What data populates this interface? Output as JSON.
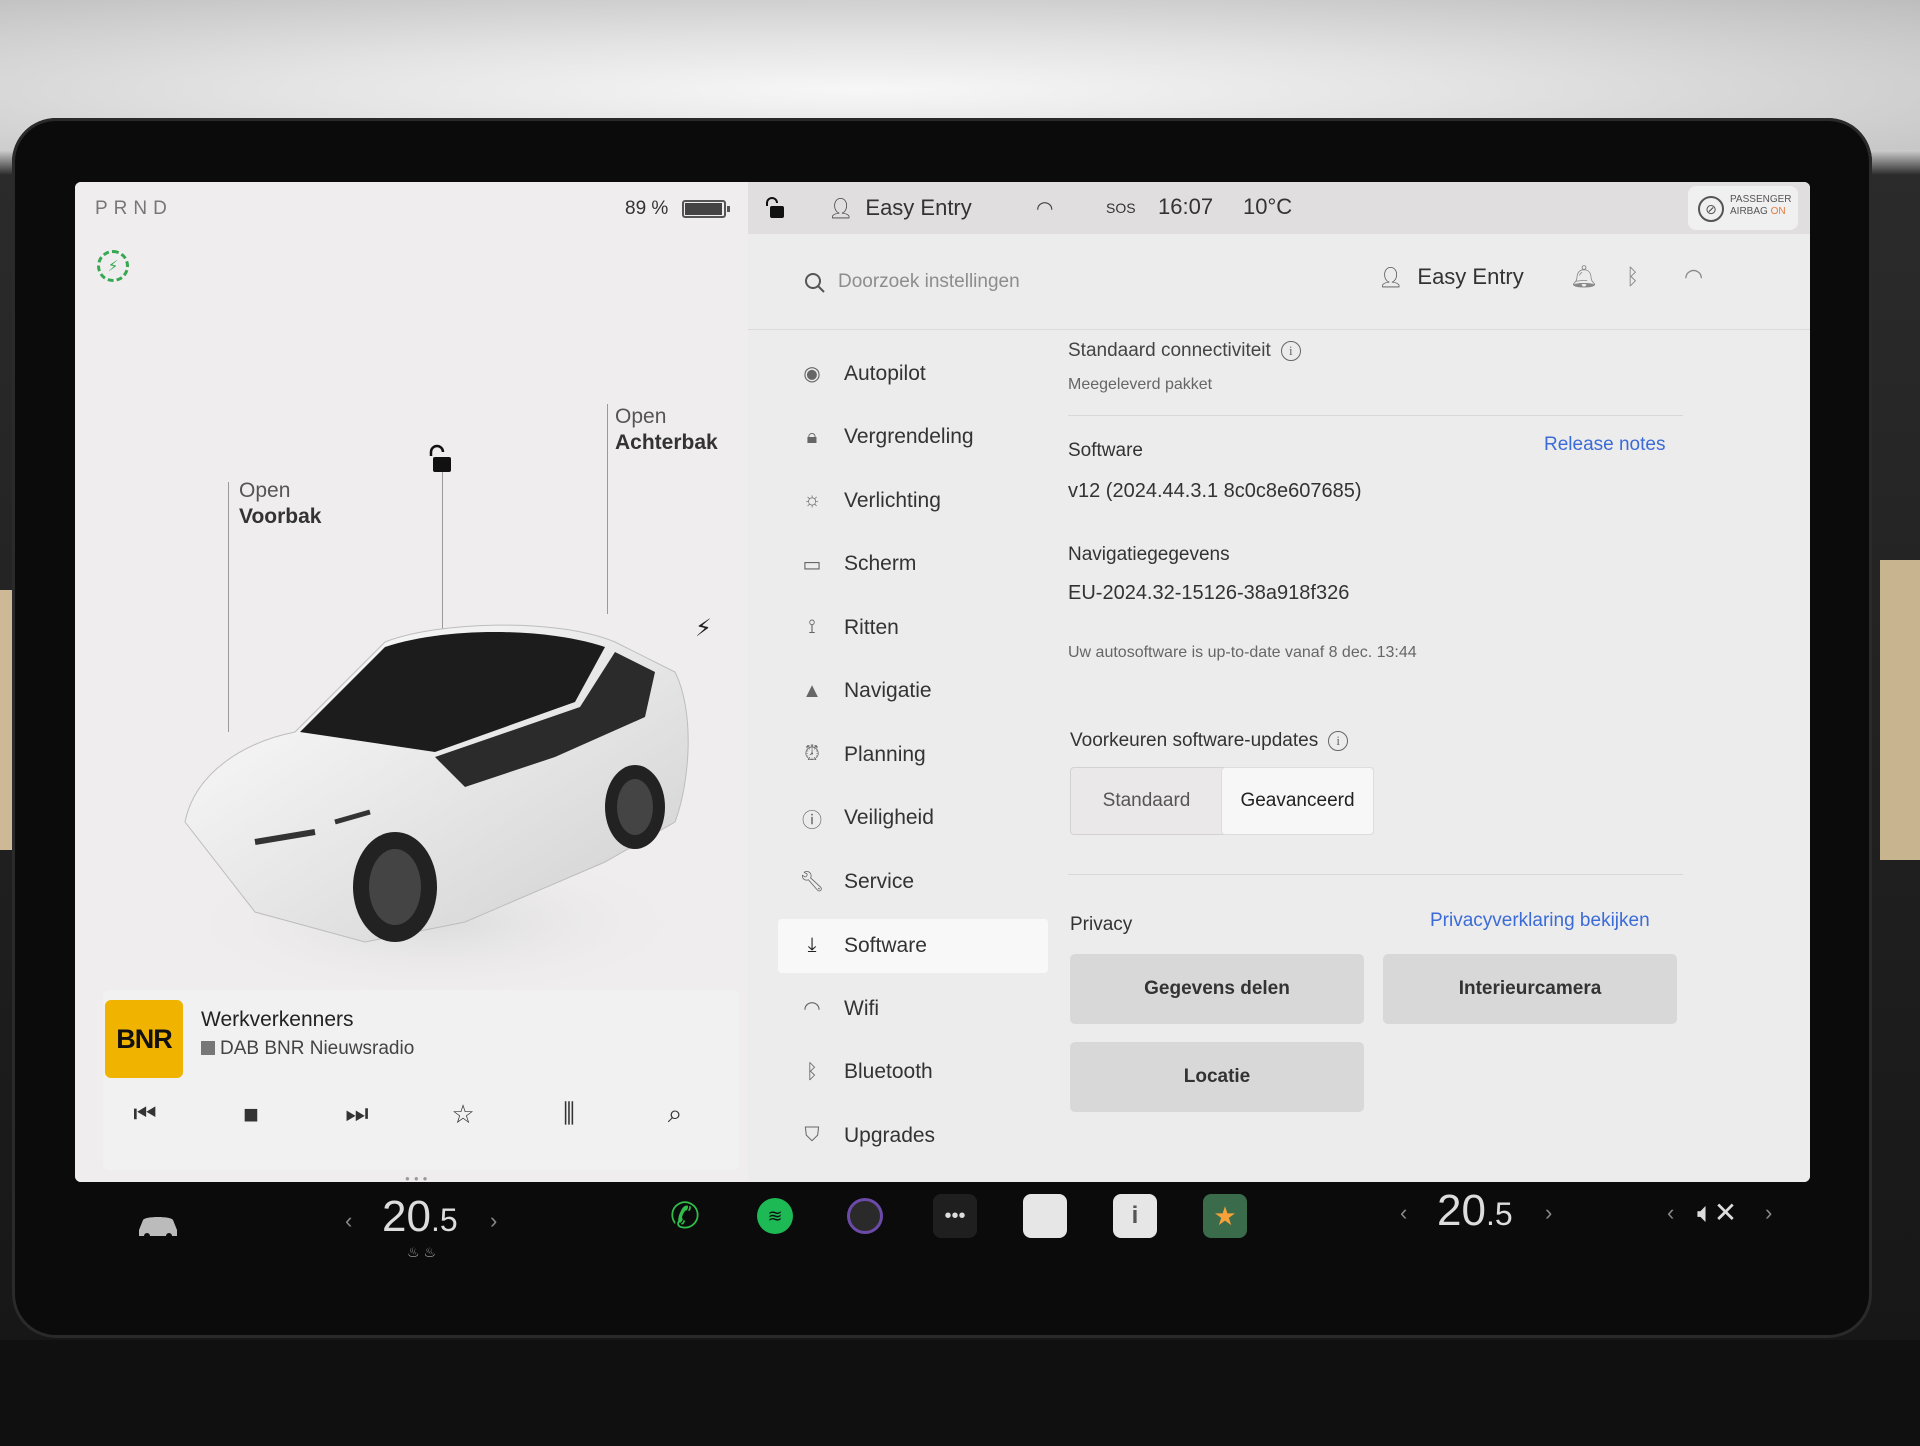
{
  "left_panel": {
    "gear": "PRND",
    "battery_pct": "89 %",
    "frunk_label_1": "Open",
    "frunk_label_2": "Voorbak",
    "trunk_label_1": "Open",
    "trunk_label_2": "Achterbak",
    "media": {
      "logo": "BNR",
      "title": "Werkverkenners",
      "station": "DAB BNR Nieuwsradio"
    }
  },
  "status_bar": {
    "profile": "Easy Entry",
    "sos": "SOS",
    "time": "16:07",
    "temperature": "10°C",
    "airbag_line1": "PASSENGER",
    "airbag_line2": "AIRBAG",
    "airbag_state": "ON"
  },
  "search": {
    "placeholder": "Doorzoek instellingen",
    "profile": "Easy Entry"
  },
  "nav": {
    "items": [
      {
        "label": "Autopilot",
        "icon": "steering-wheel-icon"
      },
      {
        "label": "Vergrendeling",
        "icon": "lock-icon"
      },
      {
        "label": "Verlichting",
        "icon": "light-icon"
      },
      {
        "label": "Scherm",
        "icon": "display-icon"
      },
      {
        "label": "Ritten",
        "icon": "trips-icon"
      },
      {
        "label": "Navigatie",
        "icon": "navigation-arrow-icon"
      },
      {
        "label": "Planning",
        "icon": "schedule-icon"
      },
      {
        "label": "Veiligheid",
        "icon": "safety-icon"
      },
      {
        "label": "Service",
        "icon": "wrench-icon"
      },
      {
        "label": "Software",
        "icon": "download-icon"
      },
      {
        "label": "Wifi",
        "icon": "wifi-icon"
      },
      {
        "label": "Bluetooth",
        "icon": "bluetooth-icon"
      },
      {
        "label": "Upgrades",
        "icon": "shopping-bag-icon"
      }
    ],
    "active": "Software"
  },
  "content": {
    "connectivity_title": "Standaard connectiviteit",
    "connectivity_sub": "Meegeleverd pakket",
    "software_label": "Software",
    "release_notes": "Release notes",
    "software_version": "v12 (2024.44.3.1 8c0c8e607685)",
    "nav_data_label": "Navigatiegegevens",
    "nav_data_version": "EU-2024.32-15126-38a918f326",
    "uptodate": "Uw autosoftware is up-to-date vanaf 8 dec. 13:44",
    "prefs_label": "Voorkeuren software-updates",
    "pref_options": [
      "Standaard",
      "Geavanceerd"
    ],
    "pref_selected": "Geavanceerd",
    "privacy_label": "Privacy",
    "privacy_link": "Privacyverklaring bekijken",
    "privacy_buttons": [
      "Gegevens delen",
      "Interieurcamera",
      "Locatie"
    ]
  },
  "taskbar": {
    "temp_left_int": "20",
    "temp_left_dec": ".5",
    "temp_right_int": "20",
    "temp_right_dec": ".5"
  },
  "colors": {
    "link": "#3b6bd6",
    "bnr": "#f0b400",
    "spotify": "#1db954",
    "phone": "#2fbf4a",
    "charge": "#36a852"
  }
}
